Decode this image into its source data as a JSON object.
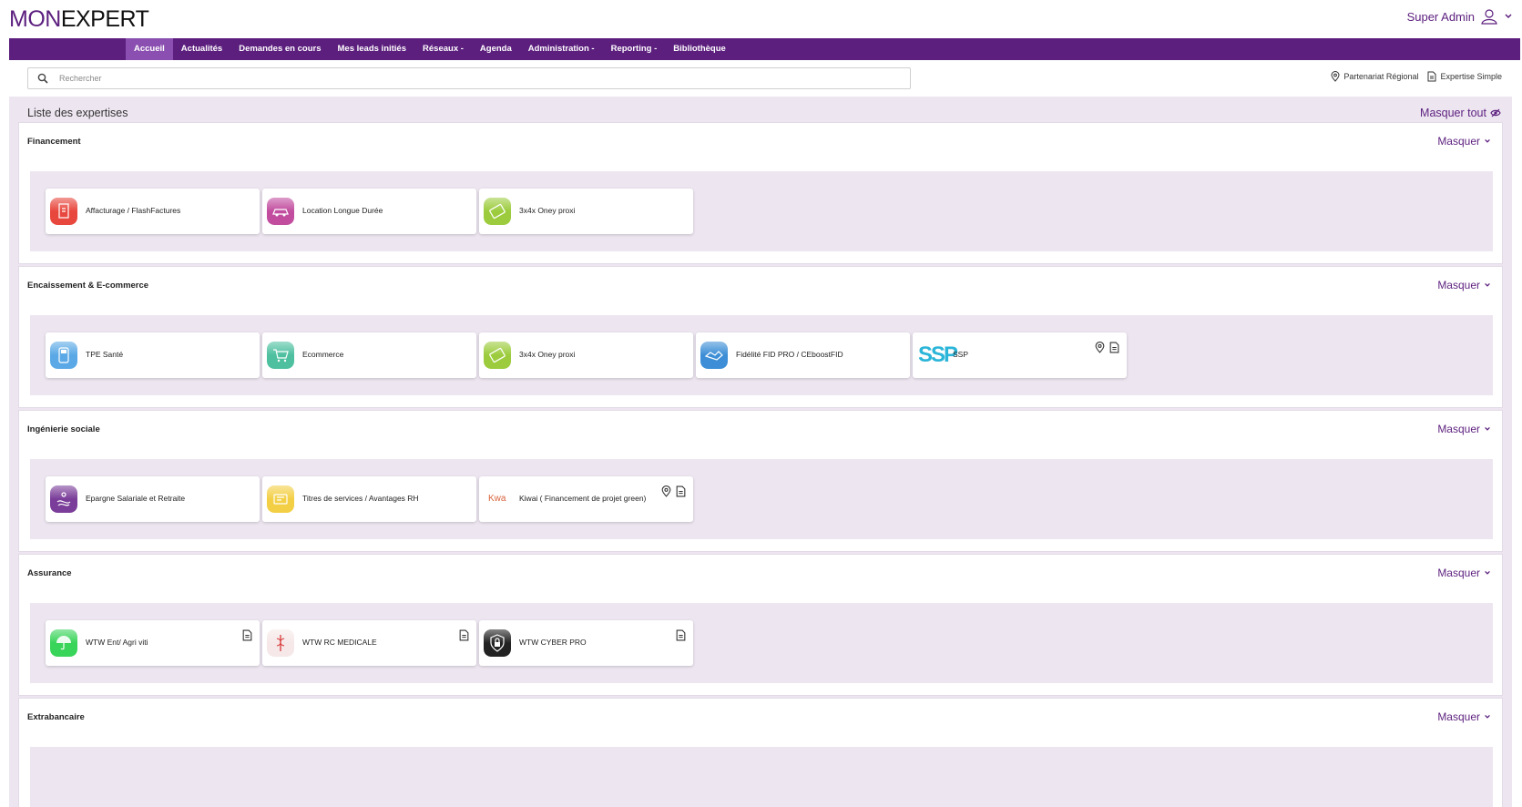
{
  "brand": {
    "part1": "MON",
    "part2": "EXPERT"
  },
  "user": {
    "name": "Super Admin"
  },
  "nav": [
    {
      "label": "Accueil",
      "active": true
    },
    {
      "label": "Actualités"
    },
    {
      "label": "Demandes en cours"
    },
    {
      "label": "Mes leads initiés"
    },
    {
      "label": "Réseaux -"
    },
    {
      "label": "Agenda"
    },
    {
      "label": "Administration -"
    },
    {
      "label": "Reporting -"
    },
    {
      "label": "Bibliothèque"
    }
  ],
  "search": {
    "placeholder": "Rechercher",
    "value": ""
  },
  "legend": {
    "regional": "Partenariat Régional",
    "simple": "Expertise Simple"
  },
  "list": {
    "title": "Liste des expertises",
    "hide_all": "Masquer tout"
  },
  "colors": {
    "brand": "#5c1f7e",
    "nav_active": "#8a4fb0",
    "content_bg": "#ede6f1"
  },
  "sections": [
    {
      "title": "Financement",
      "toggle": "Masquer",
      "cards": [
        {
          "label": "Affacturage / FlashFactures",
          "icon": "invoice-icon",
          "color": "#e8473d",
          "flags": []
        },
        {
          "label": "Location Longue Durée",
          "icon": "car-icon",
          "color": "#c24d9f",
          "flags": []
        },
        {
          "label": "3x4x Oney proxi",
          "icon": "card-icon",
          "color": "#9ccc3d",
          "flags": []
        }
      ]
    },
    {
      "title": "Encaissement & E-commerce",
      "toggle": "Masquer",
      "cards": [
        {
          "label": "TPE Santé",
          "icon": "terminal-icon",
          "color": "#5aa9e6",
          "flags": []
        },
        {
          "label": "Ecommerce",
          "icon": "cart-icon",
          "color": "#4ec0a0",
          "flags": []
        },
        {
          "label": "3x4x Oney proxi",
          "icon": "card-icon",
          "color": "#9ccc3d",
          "flags": []
        },
        {
          "label": "Fidélité FID PRO / CEboostFID",
          "icon": "handshake-icon",
          "color": "#3d8ed6",
          "flags": []
        },
        {
          "label": "SSP",
          "icon": "ssp-logo-icon",
          "logo_text": "SSP",
          "color": "#2bb5d8",
          "flags": [
            "regional",
            "simple"
          ]
        }
      ]
    },
    {
      "title": "Ingénierie sociale",
      "toggle": "Masquer",
      "cards": [
        {
          "label": "Epargne Salariale et Retraite",
          "icon": "savings-icon",
          "color": "#7a3d99",
          "flags": []
        },
        {
          "label": "Titres de services / Avantages RH",
          "icon": "voucher-icon",
          "color": "#f3cf45",
          "flags": []
        },
        {
          "label": "Kiwai ( Financement de projet green)",
          "icon": "kiwai-logo-icon",
          "logo_text": "Kwa",
          "color": "#d9623b",
          "flags": [
            "regional",
            "simple"
          ]
        }
      ]
    },
    {
      "title": "Assurance",
      "toggle": "Masquer",
      "cards": [
        {
          "label": "WTW Ent/ Agri viti",
          "icon": "umbrella-icon",
          "color": "#39d45a",
          "flags": [
            "simple"
          ]
        },
        {
          "label": "WTW RC MEDICALE",
          "icon": "caduceus-icon",
          "color": "#f6e8e8",
          "flags": [
            "simple"
          ]
        },
        {
          "label": "WTW CYBER PRO",
          "icon": "shield-lock-icon",
          "color": "#222222",
          "flags": [
            "simple"
          ]
        }
      ]
    },
    {
      "title": "Extrabancaire",
      "toggle": "Masquer",
      "cards": []
    }
  ]
}
